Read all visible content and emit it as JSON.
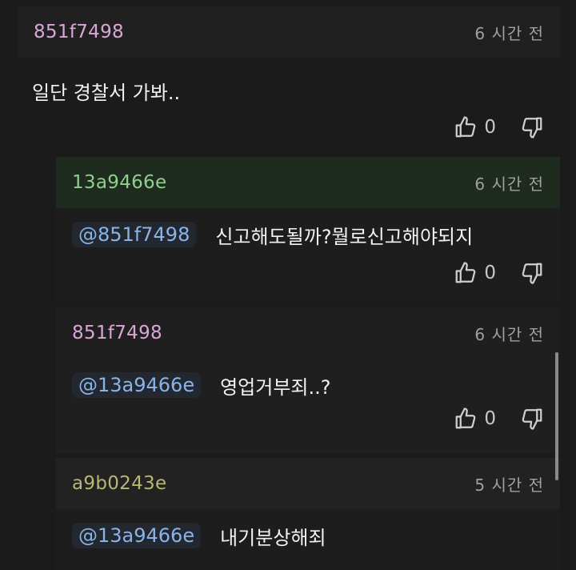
{
  "comments": [
    {
      "author": "851f7498",
      "time": "6 시간 전",
      "mention": "",
      "text": "일단 경찰서 가봐..",
      "likes": "0"
    },
    {
      "author": "13a9466e",
      "time": "6 시간 전",
      "mention": "@851f7498",
      "text": "신고해도될까?뭘로신고해야되지",
      "likes": "0"
    },
    {
      "author": "851f7498",
      "time": "6 시간 전",
      "mention": "@13a9466e",
      "text": "영업거부죄..?",
      "likes": "0"
    },
    {
      "author": "a9b0243e",
      "time": "5 시간 전",
      "mention": "@13a9466e",
      "text": "내기분상해죄"
    }
  ],
  "icons": {
    "like": "thumbs-up-icon",
    "dislike": "thumbs-down-icon"
  }
}
